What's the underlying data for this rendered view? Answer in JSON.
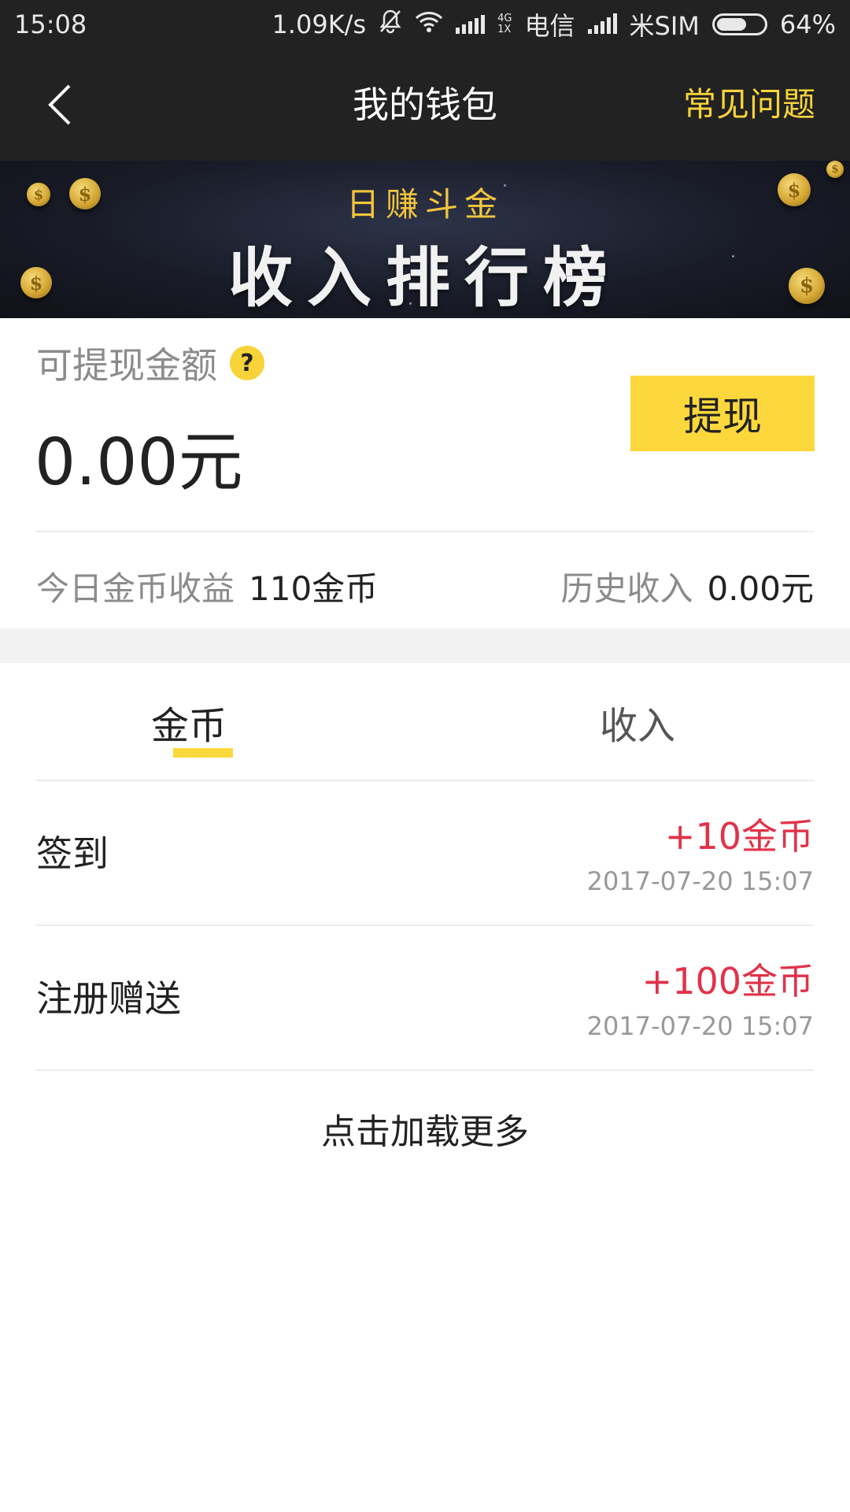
{
  "status_bar": {
    "time": "15:08",
    "net_speed": "1.09K/s",
    "net_type_top": "4G",
    "net_type_bottom": "1X",
    "carrier1": "电信",
    "carrier2": "米SIM",
    "battery": "64%",
    "battery_level": 0.64
  },
  "nav": {
    "back_icon": "chevron-left-icon",
    "title": "我的钱包",
    "faq": "常见问题"
  },
  "banner": {
    "subtitle": "日赚斗金",
    "title": "收入排行榜"
  },
  "balance": {
    "label": "可提现金额",
    "help_glyph": "?",
    "amount": "0.00元",
    "withdraw_button": "提现",
    "today_label": "今日金币收益",
    "today_value": "110金币",
    "history_label": "历史收入",
    "history_value": "0.00元"
  },
  "tabs": [
    {
      "label": "金币",
      "active": true
    },
    {
      "label": "收入",
      "active": false
    }
  ],
  "records": [
    {
      "name": "签到",
      "delta": "+10金币",
      "time": "2017-07-20 15:07"
    },
    {
      "name": "注册赠送",
      "delta": "+100金币",
      "time": "2017-07-20 15:07"
    }
  ],
  "load_more": "点击加载更多",
  "colors": {
    "accent": "#fcd83d",
    "faq": "#f7d33a",
    "positive": "#e0334a",
    "header_bg": "#222222"
  }
}
